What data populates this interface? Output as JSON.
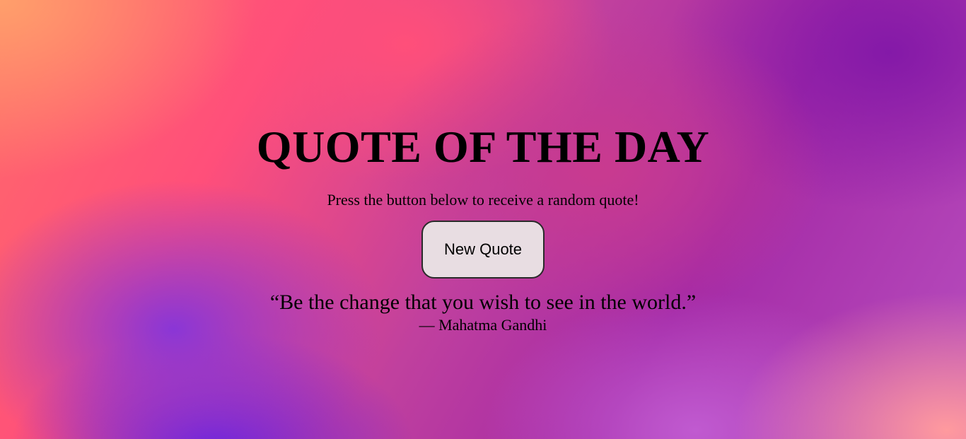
{
  "page": {
    "title": "QUOTE OF THE DAY",
    "subtitle": "Press the button below to receive a random quote!",
    "button_label": "New Quote",
    "quote_text": "“Be the change that you wish to see in the world.”",
    "quote_author": "— Mahatma Gandhi"
  },
  "colors": {
    "background_gradient": [
      "#ff9f6b",
      "#ff4f7a",
      "#c93a8f",
      "#8419a8",
      "#6a22dd",
      "#c05ad0",
      "#ff9a9e"
    ],
    "button_background": "#e8dde2",
    "text": "#000000"
  }
}
